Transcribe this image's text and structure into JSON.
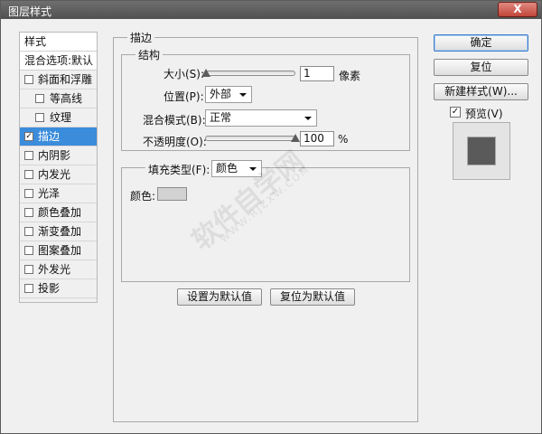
{
  "window": {
    "title": "图层样式",
    "close_label": "X"
  },
  "styles_panel": {
    "header": "样式",
    "blend_options": "混合选项:默认",
    "items": [
      {
        "label": "斜面和浮雕",
        "checked": false,
        "indent": false,
        "selected": false
      },
      {
        "label": "等高线",
        "checked": false,
        "indent": true,
        "selected": false
      },
      {
        "label": "纹理",
        "checked": false,
        "indent": true,
        "selected": false
      },
      {
        "label": "描边",
        "checked": true,
        "indent": false,
        "selected": true
      },
      {
        "label": "内阴影",
        "checked": false,
        "indent": false,
        "selected": false
      },
      {
        "label": "内发光",
        "checked": false,
        "indent": false,
        "selected": false
      },
      {
        "label": "光泽",
        "checked": false,
        "indent": false,
        "selected": false
      },
      {
        "label": "颜色叠加",
        "checked": false,
        "indent": false,
        "selected": false
      },
      {
        "label": "渐变叠加",
        "checked": false,
        "indent": false,
        "selected": false
      },
      {
        "label": "图案叠加",
        "checked": false,
        "indent": false,
        "selected": false
      },
      {
        "label": "外发光",
        "checked": false,
        "indent": false,
        "selected": false
      },
      {
        "label": "投影",
        "checked": false,
        "indent": false,
        "selected": false
      }
    ]
  },
  "stroke": {
    "group_title": "描边",
    "structure": {
      "title": "结构",
      "size_label": "大小(S):",
      "size_value": "1",
      "size_unit": "像素",
      "size_fraction": 0.0,
      "position_label": "位置(P):",
      "position_value": "外部",
      "blend_mode_label": "混合模式(B):",
      "blend_mode_value": "正常",
      "opacity_label": "不透明度(O):",
      "opacity_value": "100",
      "opacity_unit": "%",
      "opacity_fraction": 1.0
    },
    "fill": {
      "type_label": "填充类型(F):",
      "type_value": "颜色",
      "color_label": "颜色:",
      "color_hex": "#d2d2d2"
    },
    "make_default_label": "设置为默认值",
    "reset_default_label": "复位为默认值"
  },
  "actions": {
    "ok_label": "确定",
    "reset_label": "复位",
    "new_style_label": "新建样式(W)...",
    "preview_label": "预览(V)",
    "preview_checked": true
  },
  "watermark": {
    "text": "软件自学网",
    "url": "WWW.RJZXW.COM"
  },
  "colors": {
    "selection": "#3b8cdb",
    "titlebar": "#5d5d5d",
    "close": "#c2463a"
  }
}
